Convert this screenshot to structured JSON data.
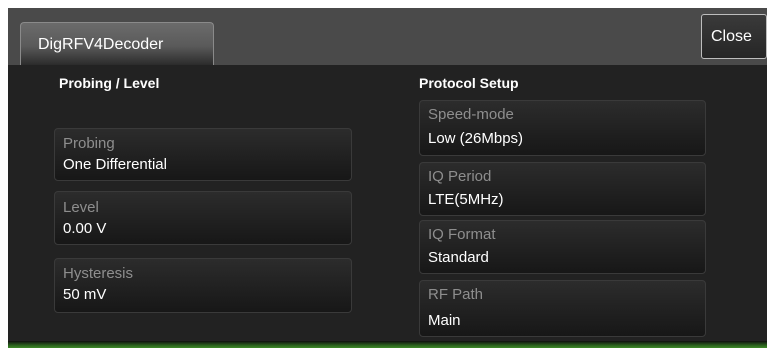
{
  "tab": {
    "label": "DigRFV4Decoder"
  },
  "close_button": {
    "label": "Close"
  },
  "probing_level": {
    "title": "Probing / Level",
    "fields": [
      {
        "label": "Probing",
        "value": "One Differential"
      },
      {
        "label": "Level",
        "value": "0.00 V"
      },
      {
        "label": "Hysteresis",
        "value": "50 mV"
      }
    ]
  },
  "protocol_setup": {
    "title": "Protocol Setup",
    "fields": [
      {
        "label": "Speed-mode",
        "value": "Low (26Mbps)"
      },
      {
        "label": "IQ Period",
        "value": "LTE(5MHz)"
      },
      {
        "label": "IQ Format",
        "value": "Standard"
      },
      {
        "label": "RF Path",
        "value": "Main"
      }
    ]
  },
  "colors": {
    "panel_bg": "#222222",
    "tab_bar_bg": "#4a4a4a",
    "label_text": "#8e8e8e",
    "value_text": "#ffffff",
    "accent_strip": "#3d8a28"
  }
}
